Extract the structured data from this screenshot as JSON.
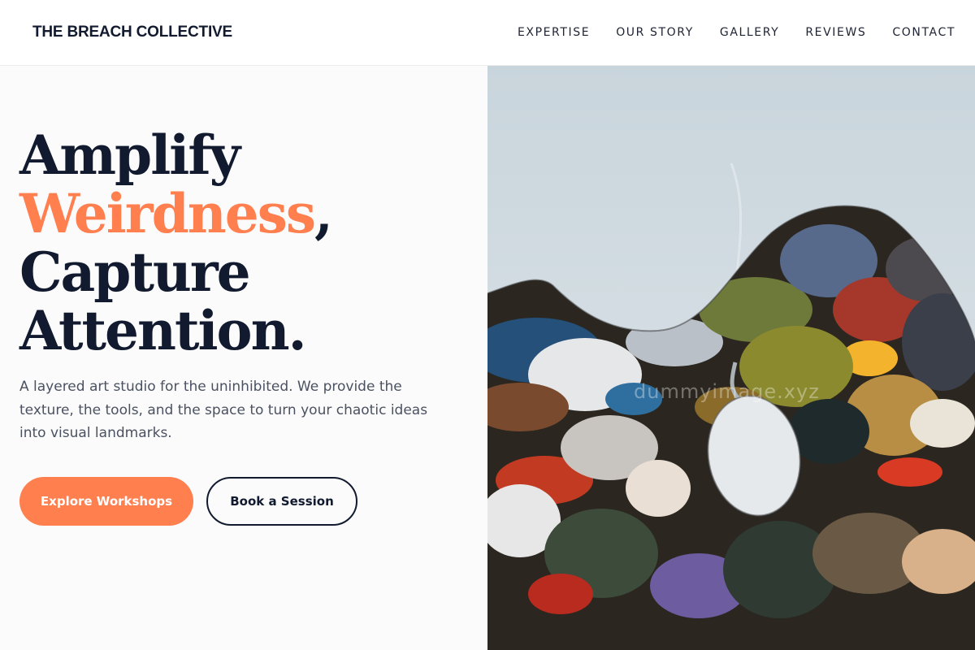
{
  "header": {
    "brand": "THE BREACH COLLECTIVE",
    "nav": [
      "EXPERTISE",
      "OUR STORY",
      "GALLERY",
      "REVIEWS",
      "CONTACT"
    ]
  },
  "hero": {
    "headline_line1": "Amplify",
    "headline_accent": "Weirdness",
    "headline_comma": ",",
    "headline_line3": "Capture",
    "headline_line4": "Attention.",
    "lede": "A layered art studio for the uninhibited. We provide the texture, the tools, and the space to turn your chaotic ideas into visual landmarks.",
    "primary_cta": "Explore Workshops",
    "secondary_cta": "Book a Session",
    "image_watermark": "dummyimage.xyz"
  },
  "colors": {
    "accent": "#ff7f4f",
    "ink": "#111a2e",
    "body_text": "#4a5161",
    "left_background": "#fbfbfb"
  }
}
